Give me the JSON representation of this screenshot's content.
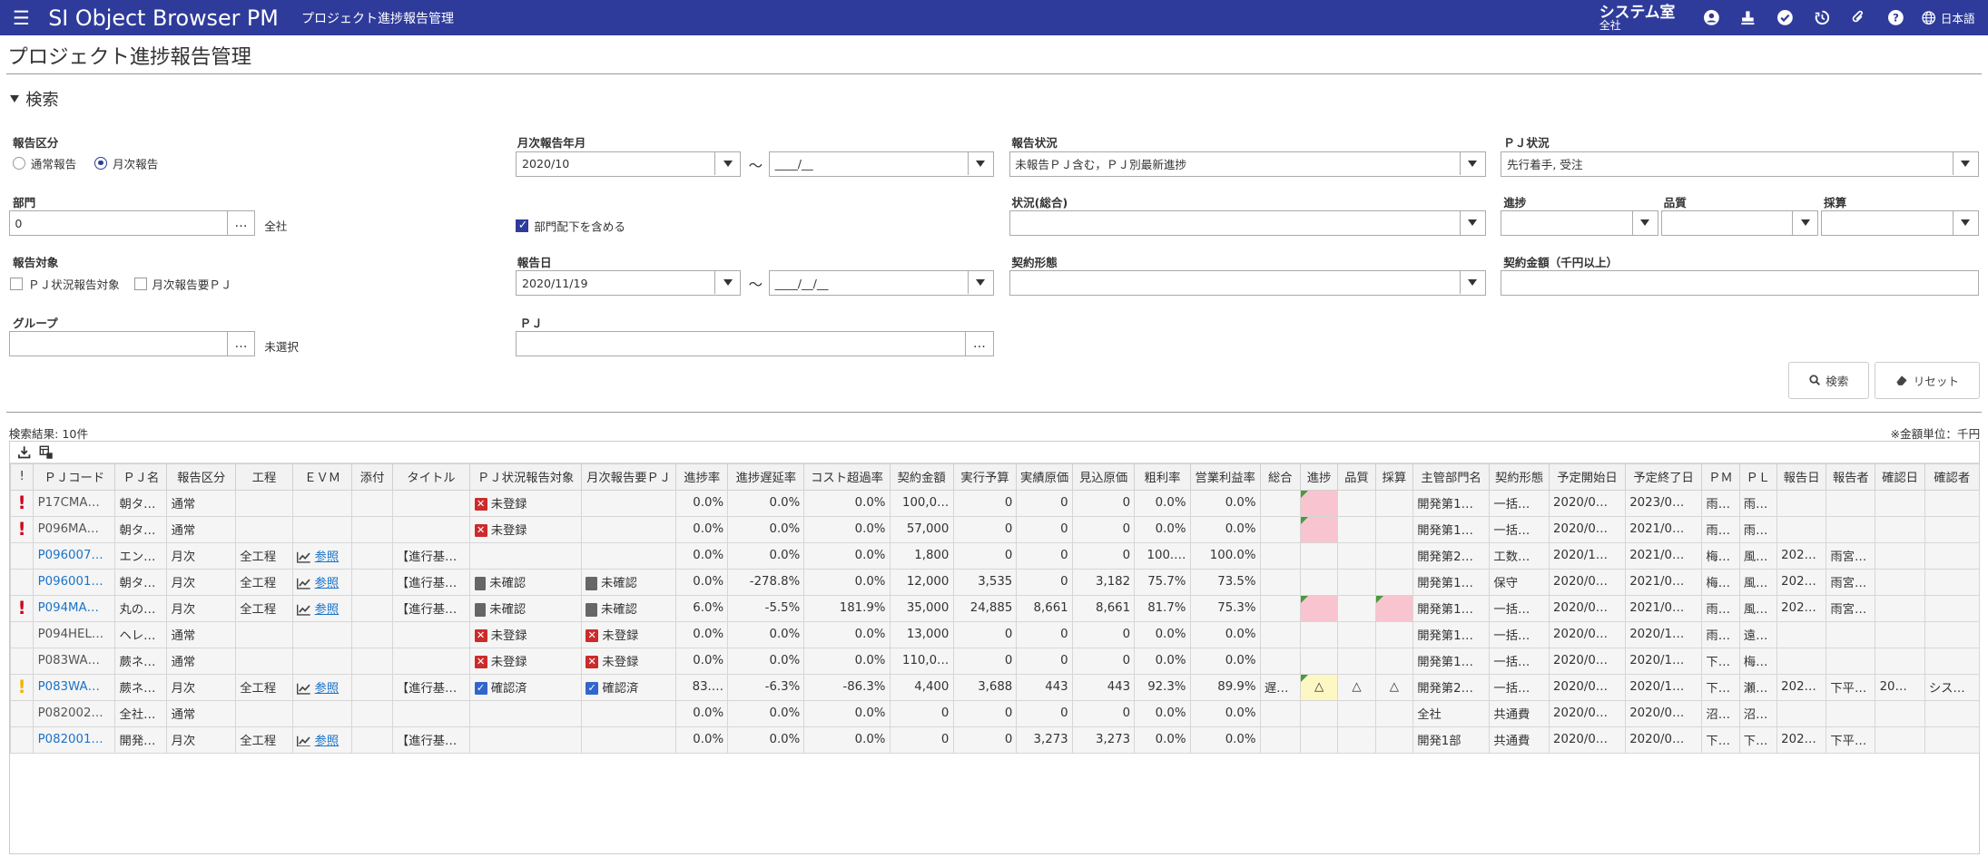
{
  "header": {
    "app_title": "SI Object Browser PM",
    "page_name": "プロジェクト進捗報告管理",
    "org_name": "システム室",
    "org_scope": "全社",
    "language": "日本語"
  },
  "page_title": "プロジェクト進捗報告管理",
  "search": {
    "section_label": "検索",
    "report_type": {
      "label": "報告区分",
      "options": [
        "通常報告",
        "月次報告"
      ],
      "selected": "月次報告"
    },
    "monthly_year": {
      "label": "月次報告年月",
      "from": "2020/10",
      "to": "____/__"
    },
    "report_status": {
      "label": "報告状況",
      "value": "未報告ＰＪ含む，ＰＪ別最新進捗"
    },
    "pj_status": {
      "label": "ＰＪ状況",
      "value": "先行着手, 受注"
    },
    "dept": {
      "label": "部門",
      "value": "0",
      "note": "全社",
      "include_sub_label": "部門配下を含める",
      "include_sub_checked": true
    },
    "overall_status": {
      "label": "状況(総合)",
      "value": ""
    },
    "progress": {
      "label": "進捗",
      "value": ""
    },
    "quality": {
      "label": "品質",
      "value": ""
    },
    "profit": {
      "label": "採算",
      "value": ""
    },
    "target": {
      "label": "報告対象",
      "opt1": "ＰＪ状況報告対象",
      "opt2": "月次報告要ＰＪ"
    },
    "report_date": {
      "label": "報告日",
      "from": "2020/11/19",
      "to": "____/__/__"
    },
    "contract_type": {
      "label": "契約形態",
      "value": ""
    },
    "contract_amount": {
      "label": "契約金額（千円以上）",
      "value": ""
    },
    "group": {
      "label": "グループ",
      "value": "",
      "note": "未選択"
    },
    "pj": {
      "label": "ＰＪ",
      "value": ""
    },
    "search_button": "検索",
    "reset_button": "リセット"
  },
  "results": {
    "count_label": "検索結果: 10件",
    "unit_note": "※金額単位：千円",
    "columns": [
      "!",
      "ＰＪコード",
      "ＰＪ名",
      "報告区分",
      "工程",
      "ＥＶＭ",
      "添付",
      "タイトル",
      "ＰＪ状況報告対象",
      "月次報告要ＰＪ",
      "進捗率",
      "進捗遅延率",
      "コスト超過率",
      "契約金額",
      "実行予算",
      "実績原価",
      "見込原価",
      "粗利率",
      "営業利益率",
      "総合",
      "進捗",
      "品質",
      "採算",
      "主管部門名",
      "契約形態",
      "予定開始日",
      "予定終了日",
      "ＰＭ",
      "ＰＬ",
      "報告日",
      "報告者",
      "確認日",
      "確認者"
    ],
    "rows": [
      {
        "flag": "red",
        "code": "P17CMA…",
        "name": "朝タ…",
        "kind": "通常",
        "process": "",
        "evm": "",
        "attach": "",
        "title": "",
        "pj_status": "未登録",
        "pj_status_type": "x",
        "monthly": "",
        "monthly_type": "",
        "rate": "0.0%",
        "delay": "0.0%",
        "cost": "0.0%",
        "amount": "100,0…",
        "budget": "0",
        "actual": "0",
        "forecast": "0",
        "gross": "0.0%",
        "op": "0.0%",
        "overall": "",
        "prog": "",
        "prog_style": "pink",
        "qual": "",
        "qual_style": "",
        "profit": "",
        "profit_style": "",
        "dept": "開発第1…",
        "contract": "一括…",
        "start": "2020/0…",
        "end": "2023/0…",
        "pm": "雨…",
        "pl": "雨…",
        "rdate": "",
        "reporter": "",
        "cdate": "",
        "checker": ""
      },
      {
        "flag": "red",
        "code": "P096MA…",
        "name": "朝タ…",
        "kind": "通常",
        "process": "",
        "evm": "",
        "attach": "",
        "title": "",
        "pj_status": "未登録",
        "pj_status_type": "x",
        "monthly": "",
        "monthly_type": "",
        "rate": "0.0%",
        "delay": "0.0%",
        "cost": "0.0%",
        "amount": "57,000",
        "budget": "0",
        "actual": "0",
        "forecast": "0",
        "gross": "0.0%",
        "op": "0.0%",
        "overall": "",
        "prog": "",
        "prog_style": "pink",
        "qual": "",
        "qual_style": "",
        "profit": "",
        "profit_style": "",
        "dept": "開発第1…",
        "contract": "一括…",
        "start": "2020/0…",
        "end": "2021/0…",
        "pm": "雨…",
        "pl": "雨…",
        "rdate": "",
        "reporter": "",
        "cdate": "",
        "checker": ""
      },
      {
        "flag": "",
        "code": "P096007…",
        "code_link": true,
        "name": "エン…",
        "kind": "月次",
        "process": "全工程",
        "evm": "参照",
        "attach": "",
        "title": "【進行基…",
        "pj_status": "",
        "pj_status_type": "",
        "monthly": "",
        "monthly_type": "",
        "rate": "0.0%",
        "delay": "0.0%",
        "cost": "0.0%",
        "amount": "1,800",
        "budget": "0",
        "actual": "0",
        "forecast": "0",
        "gross": "100.…",
        "op": "100.0%",
        "overall": "",
        "prog": "",
        "prog_style": "",
        "qual": "",
        "qual_style": "",
        "profit": "",
        "profit_style": "",
        "dept": "開発第2…",
        "contract": "工数…",
        "start": "2020/1…",
        "end": "2021/0…",
        "pm": "梅…",
        "pl": "風…",
        "rdate": "202…",
        "reporter": "雨宮…",
        "cdate": "",
        "checker": ""
      },
      {
        "flag": "",
        "code": "P096001…",
        "code_link": true,
        "name": "朝タ…",
        "kind": "月次",
        "process": "全工程",
        "evm": "参照",
        "attach": "",
        "title": "【進行基…",
        "pj_status": "未確認",
        "pj_status_type": "doc",
        "monthly": "未確認",
        "monthly_type": "doc",
        "rate": "0.0%",
        "delay": "-278.8%",
        "cost": "0.0%",
        "amount": "12,000",
        "budget": "3,535",
        "actual": "0",
        "forecast": "3,182",
        "gross": "75.7%",
        "op": "73.5%",
        "overall": "",
        "prog": "",
        "prog_style": "",
        "qual": "",
        "qual_style": "",
        "profit": "",
        "profit_style": "",
        "dept": "開発第1…",
        "contract": "保守",
        "start": "2020/0…",
        "end": "2021/0…",
        "pm": "梅…",
        "pl": "風…",
        "rdate": "202…",
        "reporter": "雨宮…",
        "cdate": "",
        "checker": ""
      },
      {
        "flag": "red",
        "code": "P094MA…",
        "code_link": true,
        "name": "丸の…",
        "kind": "月次",
        "process": "全工程",
        "evm": "参照",
        "attach": "",
        "title": "【進行基…",
        "pj_status": "未確認",
        "pj_status_type": "doc",
        "monthly": "未確認",
        "monthly_type": "doc",
        "rate": "6.0%",
        "delay": "-5.5%",
        "cost": "181.9%",
        "amount": "35,000",
        "budget": "24,885",
        "actual": "8,661",
        "forecast": "8,661",
        "gross": "81.7%",
        "op": "75.3%",
        "overall": "",
        "prog": "",
        "prog_style": "pink",
        "qual": "",
        "qual_style": "",
        "profit": "",
        "profit_style": "pink",
        "dept": "開発第1…",
        "contract": "一括…",
        "start": "2020/0…",
        "end": "2021/0…",
        "pm": "雨…",
        "pl": "風…",
        "rdate": "202…",
        "reporter": "雨宮…",
        "cdate": "",
        "checker": ""
      },
      {
        "flag": "",
        "code": "P094HEL…",
        "name": "ヘレ…",
        "kind": "通常",
        "process": "",
        "evm": "",
        "attach": "",
        "title": "",
        "pj_status": "未登録",
        "pj_status_type": "x",
        "monthly": "未登録",
        "monthly_type": "x",
        "rate": "0.0%",
        "delay": "0.0%",
        "cost": "0.0%",
        "amount": "13,000",
        "budget": "0",
        "actual": "0",
        "forecast": "0",
        "gross": "0.0%",
        "op": "0.0%",
        "overall": "",
        "prog": "",
        "prog_style": "",
        "qual": "",
        "qual_style": "",
        "profit": "",
        "profit_style": "",
        "dept": "開発第1…",
        "contract": "一括…",
        "start": "2020/0…",
        "end": "2020/1…",
        "pm": "雨…",
        "pl": "遠…",
        "rdate": "",
        "reporter": "",
        "cdate": "",
        "checker": ""
      },
      {
        "flag": "",
        "code": "P083WA…",
        "name": "蕨ネ…",
        "kind": "通常",
        "process": "",
        "evm": "",
        "attach": "",
        "title": "",
        "pj_status": "未登録",
        "pj_status_type": "x",
        "monthly": "未登録",
        "monthly_type": "x",
        "rate": "0.0%",
        "delay": "0.0%",
        "cost": "0.0%",
        "amount": "110,0…",
        "budget": "0",
        "actual": "0",
        "forecast": "0",
        "gross": "0.0%",
        "op": "0.0%",
        "overall": "",
        "prog": "",
        "prog_style": "",
        "qual": "",
        "qual_style": "",
        "profit": "",
        "profit_style": "",
        "dept": "開発第1…",
        "contract": "一括…",
        "start": "2020/0…",
        "end": "2020/1…",
        "pm": "下…",
        "pl": "梅…",
        "rdate": "",
        "reporter": "",
        "cdate": "",
        "checker": ""
      },
      {
        "flag": "yellow",
        "code": "P083WA…",
        "code_link": true,
        "name": "蕨ネ…",
        "kind": "月次",
        "process": "全工程",
        "evm": "参照",
        "attach": "",
        "title": "【進行基…",
        "pj_status": "確認済",
        "pj_status_type": "ok",
        "monthly": "確認済",
        "monthly_type": "ok",
        "rate": "83.…",
        "delay": "-6.3%",
        "cost": "-86.3%",
        "amount": "4,400",
        "budget": "3,688",
        "actual": "443",
        "forecast": "443",
        "gross": "92.3%",
        "op": "89.9%",
        "overall": "遅…",
        "prog": "△",
        "prog_style": "yel",
        "qual": "△",
        "qual_style": "",
        "profit": "△",
        "profit_style": "",
        "dept": "開発第2…",
        "contract": "一括…",
        "start": "2020/0…",
        "end": "2020/1…",
        "pm": "下…",
        "pl": "瀬…",
        "rdate": "202…",
        "reporter": "下平…",
        "cdate": "20…",
        "checker": "シス…"
      },
      {
        "flag": "",
        "code": "P082002…",
        "name": "全社…",
        "kind": "通常",
        "process": "",
        "evm": "",
        "attach": "",
        "title": "",
        "pj_status": "",
        "pj_status_type": "",
        "monthly": "",
        "monthly_type": "",
        "rate": "0.0%",
        "delay": "0.0%",
        "cost": "0.0%",
        "amount": "0",
        "budget": "0",
        "actual": "0",
        "forecast": "0",
        "gross": "0.0%",
        "op": "0.0%",
        "overall": "",
        "prog": "",
        "prog_style": "",
        "qual": "",
        "qual_style": "",
        "profit": "",
        "profit_style": "",
        "dept": "全社",
        "contract": "共通費",
        "start": "2020/0…",
        "end": "2020/0…",
        "pm": "沼…",
        "pl": "沼…",
        "rdate": "",
        "reporter": "",
        "cdate": "",
        "checker": ""
      },
      {
        "flag": "",
        "code": "P082001…",
        "code_link": true,
        "name": "開発…",
        "kind": "月次",
        "process": "全工程",
        "evm": "参照",
        "attach": "",
        "title": "【進行基…",
        "pj_status": "",
        "pj_status_type": "",
        "monthly": "",
        "monthly_type": "",
        "rate": "0.0%",
        "delay": "0.0%",
        "cost": "0.0%",
        "amount": "0",
        "budget": "0",
        "actual": "3,273",
        "forecast": "3,273",
        "gross": "0.0%",
        "op": "0.0%",
        "overall": "",
        "prog": "",
        "prog_style": "",
        "qual": "",
        "qual_style": "",
        "profit": "",
        "profit_style": "",
        "dept": "開発1部",
        "contract": "共通費",
        "start": "2020/0…",
        "end": "2020/0…",
        "pm": "下…",
        "pl": "下…",
        "rdate": "202…",
        "reporter": "下平…",
        "cdate": "",
        "checker": ""
      }
    ]
  },
  "colors": {
    "header_bg": "#2f3b9b",
    "link": "#1a73c9",
    "warn_pink": "#f8c4cf",
    "warn_yellow": "#fdf7c3",
    "alert_red": "#d0021b"
  }
}
